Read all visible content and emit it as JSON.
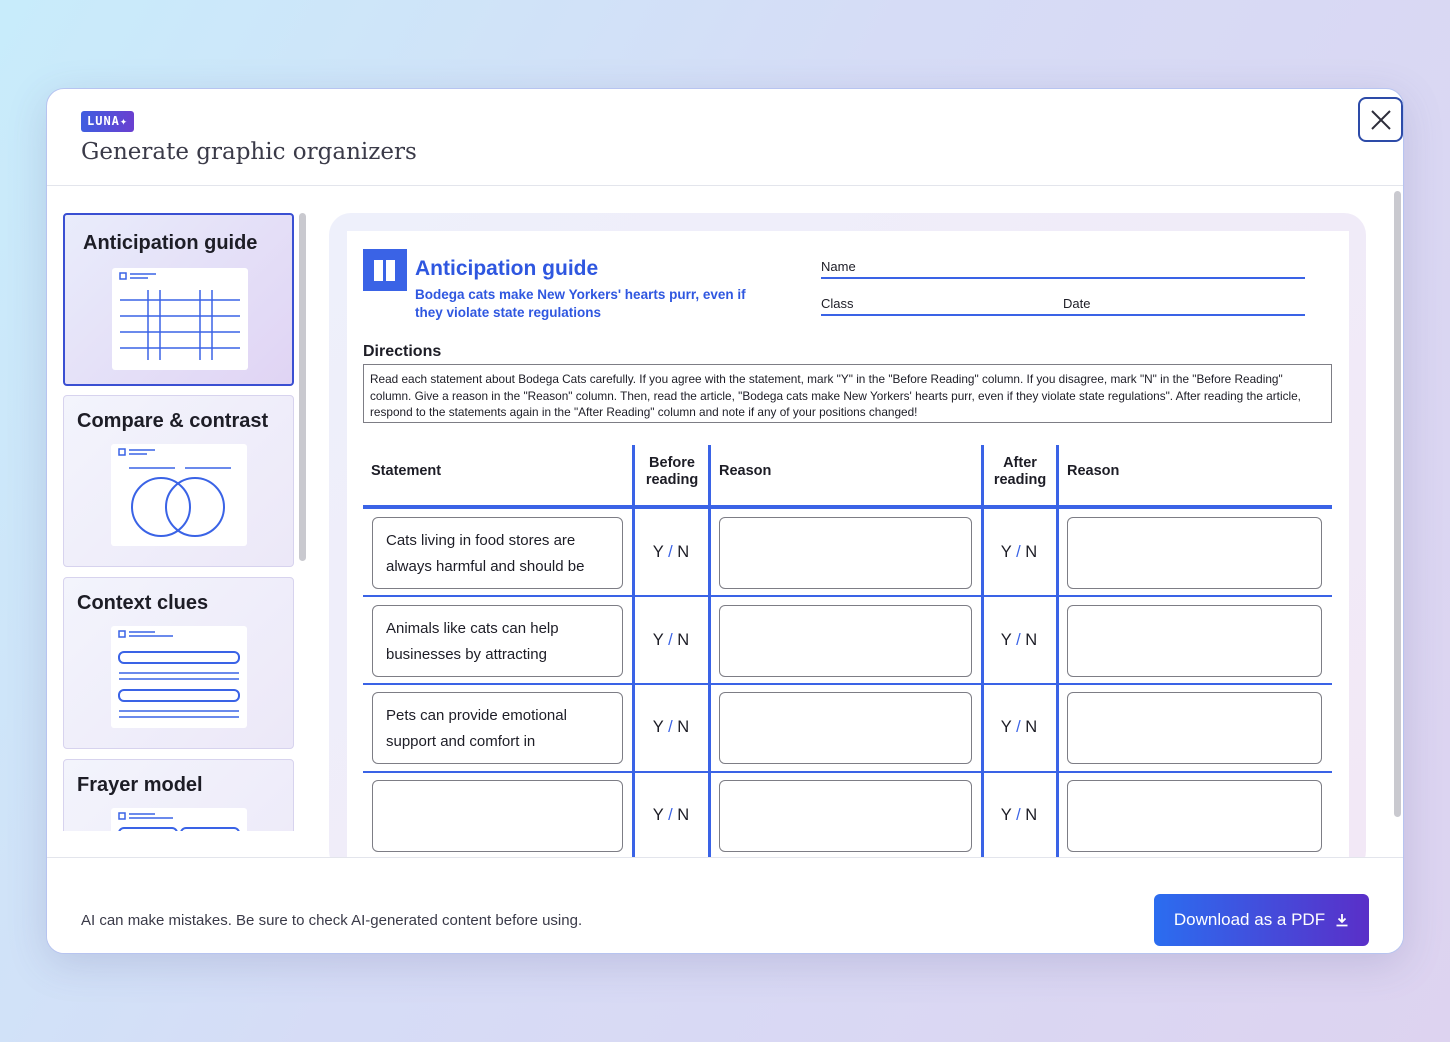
{
  "header": {
    "badge": "LUNA",
    "title": "Generate graphic organizers"
  },
  "sidebar": {
    "items": [
      {
        "label": "Anticipation guide",
        "thumb": "table-thumb",
        "active": true
      },
      {
        "label": "Compare & contrast",
        "thumb": "venn-thumb"
      },
      {
        "label": "Context clues",
        "thumb": "lines-thumb"
      },
      {
        "label": "Frayer model",
        "thumb": "frayer-thumb"
      }
    ]
  },
  "sheet": {
    "title": "Anticipation guide",
    "subtitle": "Bodega cats make New Yorkers' hearts purr, even if they violate state regulations",
    "fields": {
      "name": "Name",
      "class": "Class",
      "date": "Date"
    },
    "directions_title": "Directions",
    "directions": "Read each statement about Bodega Cats carefully. If you agree with the statement, mark \"Y\" in the \"Before Reading\" column. If you disagree, mark \"N\" in the \"Before Reading\" column. Give a reason in the \"Reason\" column. Then, read the article, \"Bodega cats make New Yorkers' hearts purr, even if they violate state regulations\". After reading the article, respond to the statements again in the \"After Reading\" column and note if any of your positions changed!",
    "columns": {
      "statement": "Statement",
      "before": "Before reading",
      "reason1": "Reason",
      "after": "After reading",
      "reason2": "Reason"
    },
    "yes": "Y",
    "no": "N",
    "slash": "/",
    "rows": [
      {
        "statement": "Cats living in food stores are always harmful and should be"
      },
      {
        "statement": "Animals like cats can help businesses by attracting"
      },
      {
        "statement": "Pets can provide emotional support and comfort in"
      },
      {
        "statement": ""
      }
    ]
  },
  "footer": {
    "disclaimer": "AI can make mistakes. Be sure to check AI-generated content before using.",
    "download_label": "Download as a PDF"
  },
  "colors": {
    "accent": "#3a63e6",
    "brand_gradient_start": "#2b6df0",
    "brand_gradient_end": "#5a2fc8"
  }
}
